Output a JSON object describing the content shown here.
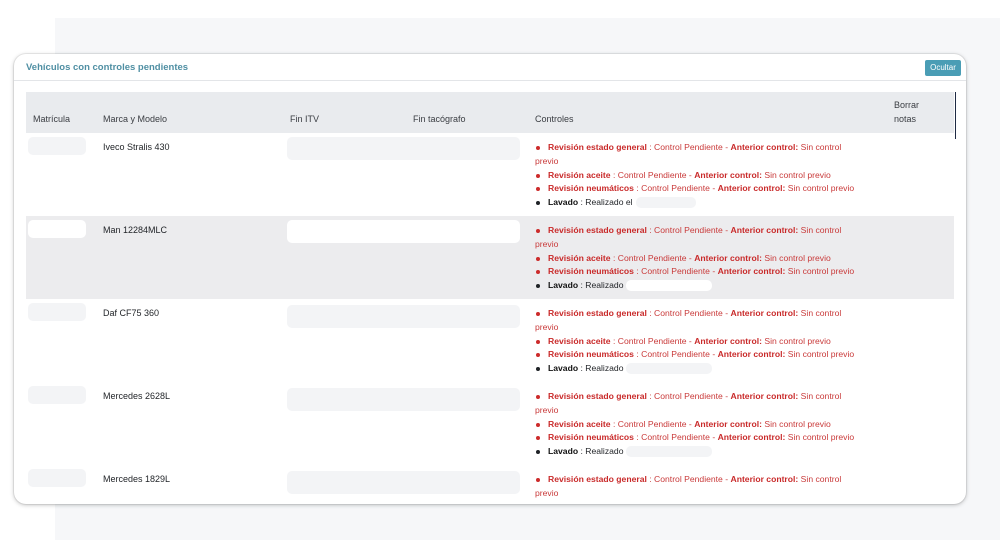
{
  "card": {
    "title": "Vehículos con controles pendientes",
    "hide_label": "Ocultar"
  },
  "table": {
    "headers": {
      "plate": "Matrícula",
      "model": "Marca y Modelo",
      "itv": "Fin ITV",
      "tacho": "Fin tacógrafo",
      "controls": "Controles",
      "delete_line1": "Borrar",
      "delete_line2": "notas"
    },
    "rows": [
      {
        "model": "Iveco Stralis 430",
        "wash_status": ": Realizado el",
        "item1_label": "Revisión estado general",
        "item1_status": ": Control Pendiente -",
        "item1_prev_label": "Anterior control:",
        "item1_prev_value": "Sin control",
        "item1_prev_value2": "previo",
        "item2_label": "Revisión aceite",
        "item2_status": ": Control Pendiente -",
        "item2_prev_label": "Anterior control:",
        "item2_prev_value": "Sin control previo",
        "item3_label": "Revisión neumáticos",
        "item3_status": ": Control Pendiente -",
        "item3_prev_label": "Anterior control:",
        "item3_prev_value": "Sin control previo",
        "wash_label": "Lavado"
      },
      {
        "model": "Man 12284MLC",
        "wash_status": ": Realizado",
        "item1_label": "Revisión estado general",
        "item1_status": ": Control Pendiente -",
        "item1_prev_label": "Anterior control:",
        "item1_prev_value": "Sin control",
        "item1_prev_value2": "previo",
        "item2_label": "Revisión aceite",
        "item2_status": ": Control Pendiente -",
        "item2_prev_label": "Anterior control:",
        "item2_prev_value": "Sin control previo",
        "item3_label": "Revisión neumáticos",
        "item3_status": ": Control Pendiente -",
        "item3_prev_label": "Anterior control:",
        "item3_prev_value": "Sin control previo",
        "wash_label": "Lavado"
      },
      {
        "model": "Daf CF75 360",
        "wash_status": ": Realizado",
        "item1_label": "Revisión estado general",
        "item1_status": ": Control Pendiente -",
        "item1_prev_label": "Anterior control:",
        "item1_prev_value": "Sin control",
        "item1_prev_value2": "previo",
        "item2_label": "Revisión aceite",
        "item2_status": ": Control Pendiente -",
        "item2_prev_label": "Anterior control:",
        "item2_prev_value": "Sin control previo",
        "item3_label": "Revisión neumáticos",
        "item3_status": ": Control Pendiente -",
        "item3_prev_label": "Anterior control:",
        "item3_prev_value": "Sin control previo",
        "wash_label": "Lavado"
      },
      {
        "model": "Mercedes 2628L",
        "wash_status": ": Realizado",
        "item1_label": "Revisión estado general",
        "item1_status": ": Control Pendiente -",
        "item1_prev_label": "Anterior control:",
        "item1_prev_value": "Sin control",
        "item1_prev_value2": "previo",
        "item2_label": "Revisión aceite",
        "item2_status": ": Control Pendiente -",
        "item2_prev_label": "Anterior control:",
        "item2_prev_value": "Sin control previo",
        "item3_label": "Revisión neumáticos",
        "item3_status": ": Control Pendiente -",
        "item3_prev_label": "Anterior control:",
        "item3_prev_value": "Sin control previo",
        "wash_label": "Lavado"
      },
      {
        "model": "Mercedes 1829L",
        "item1_label": "Revisión estado general",
        "item1_status": ": Control Pendiente -",
        "item1_prev_label": "Anterior control:",
        "item1_prev_value": "Sin control",
        "item1_prev_value2": "previo"
      }
    ]
  },
  "colors": {
    "accent": "#4a9db5",
    "title": "#4f8fa3",
    "pending_red": "#c92a2a",
    "header_bg": "#e9ebee",
    "alt_row_bg": "#ececee"
  }
}
